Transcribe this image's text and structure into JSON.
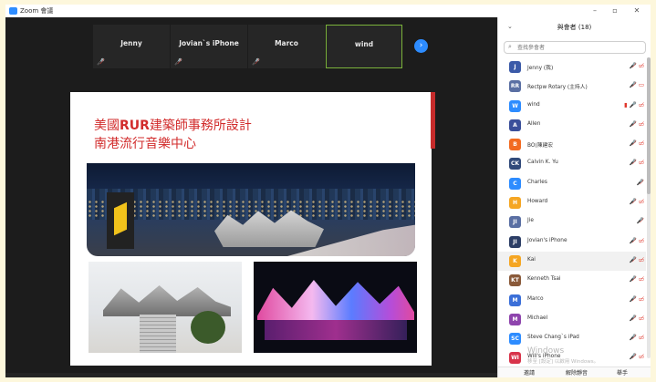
{
  "window": {
    "title": "Zoom 會議",
    "controls": [
      "–",
      "▫",
      "✕"
    ]
  },
  "meeting": {
    "tiles": [
      {
        "name": "Jenny",
        "muted": true,
        "active": false
      },
      {
        "name": "Jovian`s iPhone",
        "muted": true,
        "active": false
      },
      {
        "name": "Marco",
        "muted": true,
        "active": false
      },
      {
        "name": "wind",
        "muted": false,
        "active": true
      }
    ],
    "next_icon": "›",
    "slide": {
      "line1_prefix": "美國",
      "line1_bold": "RUR",
      "line1_suffix": "建築師事務所設計",
      "line2": "南港流行音樂中心"
    }
  },
  "panel": {
    "collapse_icon": "⌄",
    "title": "與會者 (18)",
    "search_placeholder": "查找參會者",
    "participants": [
      {
        "initials": "J",
        "name": "Jenny (我)",
        "color": "#3b5aa8",
        "status": "🎤̸ ▭̸"
      },
      {
        "initials": "RR",
        "name": "Rectpw Rotary (主持人)",
        "color": "#5a6fa3",
        "status": "🎤̸ ▭"
      },
      {
        "initials": "W",
        "name": "wind",
        "color": "#2d8cff",
        "status": "▮ 🎤 ▭̸"
      },
      {
        "initials": "A",
        "name": "Allen",
        "color": "#3a4f9a",
        "status": "🎤̸ ▭̸"
      },
      {
        "initials": "B",
        "name": "BO(陳建宏",
        "color": "#f26b21",
        "status": "🎤̸ ▭̸"
      },
      {
        "initials": "CK",
        "name": "Calvin K. Yu",
        "color": "#314a7a",
        "status": "🎤̸ ▭̸"
      },
      {
        "initials": "C",
        "name": "Charles",
        "color": "#2d8cff",
        "status": "🎤̸"
      },
      {
        "initials": "H",
        "name": "Howard",
        "color": "#f5a623",
        "status": "🎤̸ ▭̸"
      },
      {
        "initials": "JI",
        "name": "Jie",
        "color": "#5a6fa3",
        "status": "🎤̸"
      },
      {
        "initials": "JI",
        "name": "Jovian's iPhone",
        "color": "#2c3e66",
        "status": "🎤̸ ▭̸"
      },
      {
        "initials": "K",
        "name": "Kai",
        "color": "#f5a623",
        "status": "🎤̸ ▭̸"
      },
      {
        "initials": "KT",
        "name": "Kenneth Tsai",
        "color": "#8a5a3a",
        "status": "🎤̸ ▭̸"
      },
      {
        "initials": "M",
        "name": "Marco",
        "color": "#3b6fd8",
        "status": "🎤̸ ▭̸"
      },
      {
        "initials": "M",
        "name": "Michael",
        "color": "#8e44ad",
        "status": "🎤̸ ▭̸"
      },
      {
        "initials": "SC",
        "name": "Steve Chang`s iPad",
        "color": "#2d8cff",
        "status": "🎤̸ ▭̸"
      },
      {
        "initials": "WI",
        "name": "Will's iPhone",
        "color": "#d8334a",
        "status": "🎤̸ ▭̸"
      }
    ],
    "footer": {
      "invite": "邀請",
      "mute_all": "解除靜音",
      "raise_hand": "舉手"
    }
  },
  "watermark": {
    "line1": "Windows",
    "line2": "移至 [設定] 以啟用 Windows。"
  },
  "colors": {
    "accent": "#2d8cff",
    "mute_red": "#e0362b",
    "active_border": "#7bb33b",
    "slide_red": "#d22c2c"
  }
}
